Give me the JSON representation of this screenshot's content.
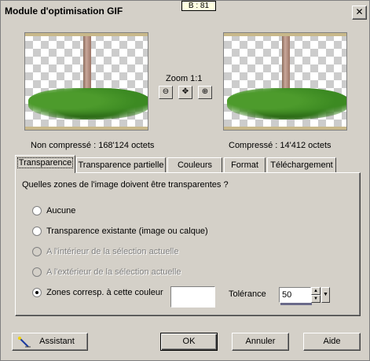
{
  "window": {
    "title": "Module d'optimisation GIF",
    "tooltip": "B : 81",
    "close_glyph": "✕"
  },
  "preview": {
    "zoom_label": "Zoom 1:1",
    "uncompressed_label": "Non compressé :  168'124 octets",
    "compressed_label": "Compressé : 14'412 octets"
  },
  "tabs": [
    {
      "label": "Transparence"
    },
    {
      "label": "Transparence partielle"
    },
    {
      "label": "Couleurs"
    },
    {
      "label": "Format"
    },
    {
      "label": "Téléchargement"
    }
  ],
  "transparence": {
    "question": "Quelles zones de l'image doivent être transparentes ?",
    "options": [
      {
        "label": "Aucune",
        "checked": false,
        "disabled": false
      },
      {
        "label": "Transparence existante (image ou calque)",
        "checked": false,
        "disabled": false
      },
      {
        "label": "A l'intérieur de la sélection actuelle",
        "checked": false,
        "disabled": true
      },
      {
        "label": "A l'extérieur de la sélection actuelle",
        "checked": false,
        "disabled": true
      },
      {
        "label": "Zones corresp. à cette couleur",
        "checked": true,
        "disabled": false
      }
    ],
    "color_swatch": "#ffffff",
    "tolerance_label": "Tolérance",
    "tolerance_value": "50"
  },
  "buttons": {
    "wizard": "Assistant",
    "ok": "OK",
    "cancel": "Annuler",
    "help": "Aide"
  }
}
